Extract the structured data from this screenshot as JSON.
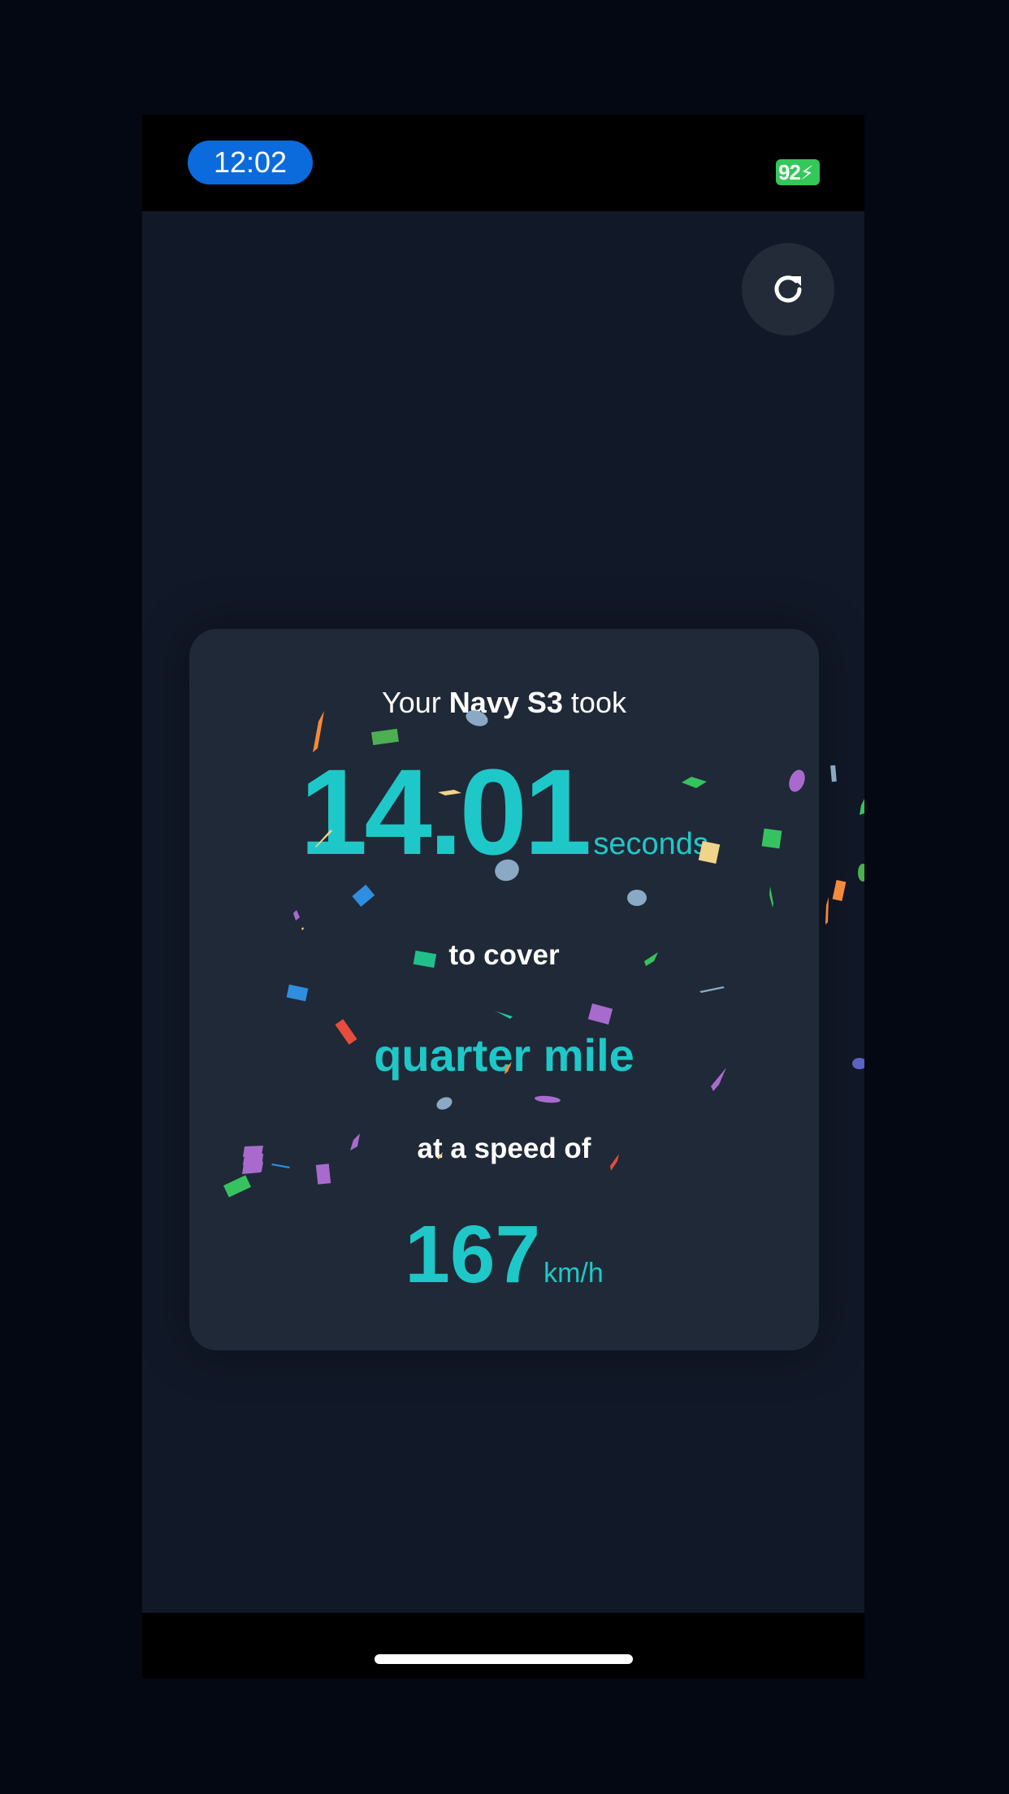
{
  "status_bar": {
    "time": "12:02",
    "battery": "92",
    "battery_state": "charging"
  },
  "toolbar": {
    "reset_icon": "refresh-icon"
  },
  "result": {
    "prefix": "Your",
    "car_name": "Navy S3",
    "suffix": "took",
    "time_value": "14.01",
    "time_unit": "seconds",
    "cover_text": "to cover",
    "distance": "quarter mile",
    "speed_text": "at a speed of",
    "speed_value": "167",
    "speed_unit": "km/h"
  },
  "colors": {
    "accent": "#1fc8c8",
    "background": "#111827",
    "card": "#1f2937",
    "time_pill": "#0b6bdc",
    "battery": "#34c759"
  }
}
